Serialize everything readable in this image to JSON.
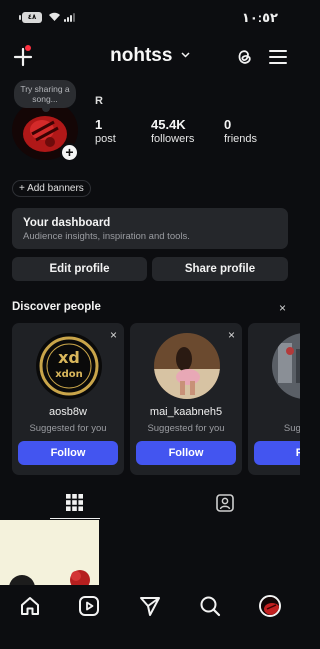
{
  "status_bar": {
    "battery_label": "٤٨",
    "time": "١٠:٥٢",
    "battery_icon": "battery-icon",
    "wifi_icon": "wifi-icon",
    "signal_icon": "signal-icon"
  },
  "header": {
    "username": "nohtss",
    "create_icon": "plus-icon",
    "threads_icon": "threads-icon",
    "menu_icon": "hamburger-icon"
  },
  "profile": {
    "note_text": "Try sharing a song...",
    "display_name": "R",
    "stats": [
      {
        "value": "1",
        "label": "post"
      },
      {
        "value": "45.4K",
        "label": "followers"
      },
      {
        "value": "0",
        "label": "friends"
      }
    ],
    "add_banners_label": "+ Add banners"
  },
  "dashboard": {
    "title": "Your dashboard",
    "subtitle": "Audience insights, inspiration and tools."
  },
  "actions": {
    "edit_profile": "Edit profile",
    "share_profile": "Share profile"
  },
  "discover": {
    "title": "Discover people",
    "close_symbol": "×",
    "cards": [
      {
        "name": "aosb8w",
        "subtitle": "Suggested for you",
        "button": "Follow",
        "close": "×"
      },
      {
        "name": "mai_kaabneh5",
        "subtitle": "Suggested for you",
        "button": "Follow",
        "close": "×"
      },
      {
        "name": "",
        "subtitle": "Suggeste",
        "button": "Fol",
        "close": ""
      }
    ],
    "first_card_logo_text": "xdon"
  },
  "tabs": {
    "grid_icon": "grid-icon",
    "tagged_icon": "tagged-person-icon"
  },
  "bottom_nav": {
    "items": [
      "home-icon",
      "reels-icon",
      "send-icon",
      "search-icon",
      "profile-avatar"
    ]
  },
  "colors": {
    "background": "#0c0d10",
    "card": "#1f2125",
    "button": "#25272b",
    "accent": "#4355f0",
    "notification": "#ff3040"
  }
}
